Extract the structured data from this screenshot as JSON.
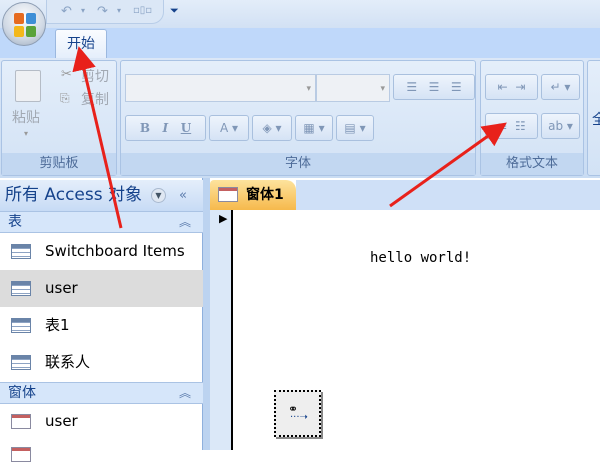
{
  "ribbon": {
    "tabs": [
      {
        "label": "开始",
        "active": true
      }
    ],
    "clipboard": {
      "label": "剪贴板",
      "paste": "粘贴",
      "cut": "剪切",
      "copy": "复制"
    },
    "font": {
      "label": "字体",
      "bold": "B",
      "italic": "I",
      "underline": "U",
      "font_color": "A"
    },
    "format_text": {
      "label": "格式文本",
      "next_group_partial": "全"
    }
  },
  "nav": {
    "title": "所有 Access 对象",
    "sections": [
      {
        "label": "表",
        "items": [
          "Switchboard Items",
          "user",
          "表1",
          "联系人"
        ],
        "selected": "user"
      },
      {
        "label": "窗体",
        "items": [
          "user"
        ]
      }
    ]
  },
  "document": {
    "tab": "窗体1",
    "label_text": "hello world!"
  },
  "colors": {
    "annotation_arrow": "#e8211b",
    "tab_active": "#f6b94c",
    "ribbon": "#d5e4f5"
  }
}
